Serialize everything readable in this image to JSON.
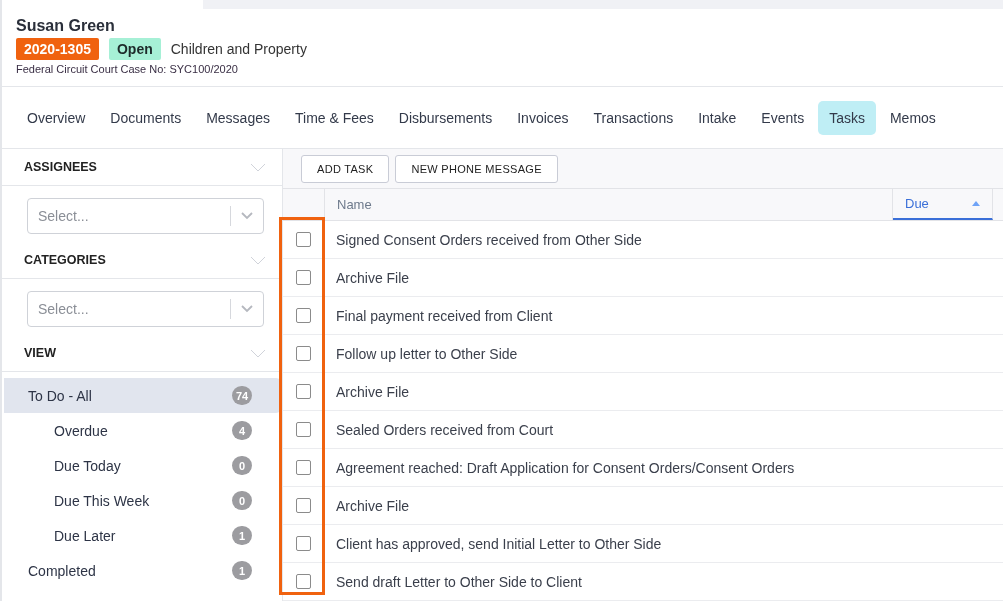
{
  "matter": {
    "client": "Susan Green",
    "number": "2020-1305",
    "status": "Open",
    "type": "Children and Property",
    "court_ref": "Federal Circuit Court Case No: SYC100/2020"
  },
  "tabs": [
    {
      "label": "Overview",
      "selected": false
    },
    {
      "label": "Documents",
      "selected": false
    },
    {
      "label": "Messages",
      "selected": false
    },
    {
      "label": "Time & Fees",
      "selected": false
    },
    {
      "label": "Disbursements",
      "selected": false
    },
    {
      "label": "Invoices",
      "selected": false
    },
    {
      "label": "Transactions",
      "selected": false
    },
    {
      "label": "Intake",
      "selected": false
    },
    {
      "label": "Events",
      "selected": false
    },
    {
      "label": "Tasks",
      "selected": true
    },
    {
      "label": "Memos",
      "selected": false
    }
  ],
  "sidebar": {
    "sections": [
      {
        "title": "ASSIGNEES",
        "kind": "select",
        "placeholder": "Select..."
      },
      {
        "title": "CATEGORIES",
        "kind": "select",
        "placeholder": "Select..."
      },
      {
        "title": "VIEW",
        "kind": "list"
      }
    ],
    "view_items": [
      {
        "label": "To Do - All",
        "count": "74",
        "selected": true,
        "children": [
          {
            "label": "Overdue",
            "count": "4",
            "selected": false
          },
          {
            "label": "Due Today",
            "count": "0",
            "selected": false
          },
          {
            "label": "Due This Week",
            "count": "0",
            "selected": false
          },
          {
            "label": "Due Later",
            "count": "1",
            "selected": false
          }
        ]
      },
      {
        "label": "Completed",
        "count": "1",
        "selected": false
      }
    ]
  },
  "toolbar": {
    "buttons": [
      "ADD TASK",
      "NEW PHONE MESSAGE"
    ]
  },
  "table": {
    "columns": [
      {
        "label": "Name",
        "sorted": false
      },
      {
        "label": "Due",
        "sorted": true
      }
    ],
    "rows": [
      {
        "name": "Signed Consent Orders received from Other Side",
        "checked": false
      },
      {
        "name": "Archive File",
        "checked": false
      },
      {
        "name": "Final payment received from Client",
        "checked": false
      },
      {
        "name": "Follow up letter to Other Side",
        "checked": false
      },
      {
        "name": "Archive File",
        "checked": false
      },
      {
        "name": "Sealed Orders received from Court",
        "checked": false
      },
      {
        "name": "Agreement reached: Draft Application for Consent Orders/Consent Orders",
        "checked": false
      },
      {
        "name": "Archive File",
        "checked": false
      },
      {
        "name": "Client has approved, send Initial Letter to Other Side",
        "checked": false
      },
      {
        "name": "Send draft Letter to Other Side to Client",
        "checked": false
      }
    ],
    "checkbox_column_highlighted": true
  }
}
